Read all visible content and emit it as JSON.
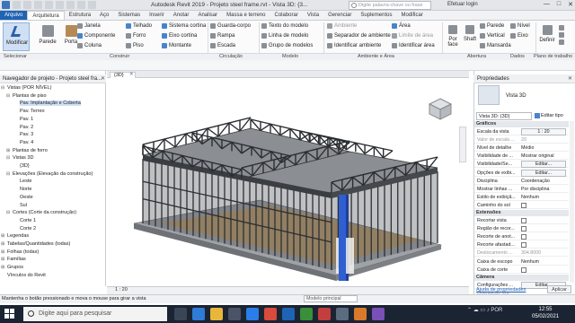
{
  "title_bar": {
    "title": "Autodesk Revit 2019 - Projeto steel frame.rvt - Vista 3D: {3...",
    "search_placeholder": "Digite palavra-chave ou frase",
    "user": "Efetuar login",
    "window_controls": [
      "—",
      "□",
      "✕"
    ]
  },
  "ribbon_tabs": [
    "Arquivo",
    "Arquitetura",
    "Estrutura",
    "Aço",
    "Sistemas",
    "Inserir",
    "Anotar",
    "Analisar",
    "Massa e terreno",
    "Colaborar",
    "Vista",
    "Gerenciar",
    "Suplementos",
    "Modificar"
  ],
  "active_tab": "Arquitetura",
  "ribbon": {
    "modify": "Modificar",
    "wall": "Parede",
    "door": "Porta",
    "build_col1": [
      "Janela",
      "Componente",
      "Coluna"
    ],
    "build_col2": [
      "Telhado",
      "Forro",
      "Piso"
    ],
    "build_col3": [
      "Sistema cortina",
      "Eixo cortina",
      "Montante"
    ],
    "circulation": [
      "Guarda-corpo",
      "Rampa",
      "Escada"
    ],
    "model": [
      "Texto do modelo",
      "Linha de modelo",
      "Grupo de modelos"
    ],
    "room_col1": [
      "Ambiente",
      "Separador de ambiente",
      "Identificar ambiente"
    ],
    "room_col2": [
      "Área",
      "Limite de área",
      "Identificar área"
    ],
    "by_face": "Por face",
    "shaft": "Shaft",
    "opening": [
      "Parede",
      "Vertical",
      "Mansarda"
    ],
    "level": "Nível",
    "grid": "Eixo",
    "set": "Definir",
    "panels": [
      "Selecionar",
      "Construir",
      "Circulação",
      "Modelo",
      "Ambiente e Área",
      "Abertura",
      "Dados",
      "Plano de trabalho"
    ]
  },
  "project_browser": {
    "title": "Navegador de projeto - Projeto steel fra...",
    "items": [
      {
        "label": "Vistas (POR NÍVEL)",
        "toggle": "⊟"
      },
      {
        "label": "Plantas de piso",
        "toggle": "⊟"
      },
      {
        "label": "Pav. Implantação e Coberta",
        "toggle": ""
      },
      {
        "label": "Pav. Terreo",
        "toggle": ""
      },
      {
        "label": "Pav. 1",
        "toggle": ""
      },
      {
        "label": "Pav. 2",
        "toggle": ""
      },
      {
        "label": "Pav. 3",
        "toggle": ""
      },
      {
        "label": "Pav. 4",
        "toggle": ""
      },
      {
        "label": "Plantas de forro",
        "toggle": "⊞"
      },
      {
        "label": "Vistas 3D",
        "toggle": "⊟"
      },
      {
        "label": "{3D}",
        "toggle": ""
      },
      {
        "label": "Elevações (Elevação da construção)",
        "toggle": "⊟"
      },
      {
        "label": "Leste",
        "toggle": ""
      },
      {
        "label": "Norte",
        "toggle": ""
      },
      {
        "label": "Oeste",
        "toggle": ""
      },
      {
        "label": "Sul",
        "toggle": ""
      },
      {
        "label": "Cortes (Corte da construção)",
        "toggle": "⊟"
      },
      {
        "label": "Corte 1",
        "toggle": ""
      },
      {
        "label": "Corte 2",
        "toggle": ""
      },
      {
        "label": "Legendas",
        "toggle": "⊞"
      },
      {
        "label": "Tabelas/Quantidades (todas)",
        "toggle": "⊞"
      },
      {
        "label": "Folhas (todas)",
        "toggle": "⊞"
      },
      {
        "label": "Famílias",
        "toggle": "⊞"
      },
      {
        "label": "Grupos",
        "toggle": "⊞"
      },
      {
        "label": "Vínculos do Revit",
        "toggle": ""
      }
    ]
  },
  "view": {
    "tab": "{3D}",
    "scale": "1 : 20"
  },
  "properties": {
    "title": "Propriedades",
    "type": "Vista 3D",
    "instance": "Vista 3D: {3D}",
    "edit_type": "Editar tipo",
    "groups": {
      "graphics": "Gráficos",
      "extents": "Extensões",
      "camera": "Câmera"
    },
    "rows_graphics": [
      {
        "k": "Escala da vista",
        "v": "1 : 20",
        "kind": "box"
      },
      {
        "k": "Valor de escala ...",
        "v": "20",
        "kind": "dim"
      },
      {
        "k": "Nível de detalhe",
        "v": "Médio",
        "kind": "text"
      },
      {
        "k": "Visibilidade de ...",
        "v": "Mostrar original",
        "kind": "text"
      },
      {
        "k": "Visibilidade/Se...",
        "v": "Editar...",
        "kind": "btn"
      },
      {
        "k": "Opções de exibi...",
        "v": "Editar...",
        "kind": "btn"
      },
      {
        "k": "Disciplina",
        "v": "Coordenação",
        "kind": "text"
      },
      {
        "k": "Mostrar linhas ...",
        "v": "Por disciplina",
        "kind": "text"
      },
      {
        "k": "Estilo de exibiçã...",
        "v": "Nenhum",
        "kind": "text"
      },
      {
        "k": "Caminho do sol",
        "v": "",
        "kind": "check"
      }
    ],
    "rows_extents": [
      {
        "k": "Recortar vista",
        "v": "",
        "kind": "check"
      },
      {
        "k": "Região de recor...",
        "v": "",
        "kind": "check"
      },
      {
        "k": "Recorte de anot...",
        "v": "",
        "kind": "check"
      },
      {
        "k": "Recorte afastad...",
        "v": "",
        "kind": "check"
      },
      {
        "k": "Deslocamento ...",
        "v": "304.8000",
        "kind": "dim"
      },
      {
        "k": "Caixa de escopo",
        "v": "Nenhum",
        "kind": "text"
      },
      {
        "k": "Caixa de corte",
        "v": "",
        "kind": "check"
      }
    ],
    "rows_camera": [
      {
        "k": "Configurações ...",
        "v": "Editar...",
        "kind": "btn"
      },
      {
        "k": "Orientação fixa",
        "v": "",
        "kind": "dim"
      }
    ],
    "help_link": "Ajuda de propriedades",
    "apply": "Aplicar"
  },
  "status": {
    "text": "Mantenha o botão pressionado e mova o mouse para girar a vista",
    "model": "Modelo principal"
  },
  "taskbar": {
    "search": "Digite aqui para pesquisar",
    "time": "12:55",
    "date": "05/02/2021",
    "lang": "POR"
  },
  "colors": {
    "accent": "#1f63b4",
    "frame": "#3a3d42",
    "slab": "#8b8e92",
    "wood": "#b99a6b",
    "column": "#2f5fd0"
  }
}
